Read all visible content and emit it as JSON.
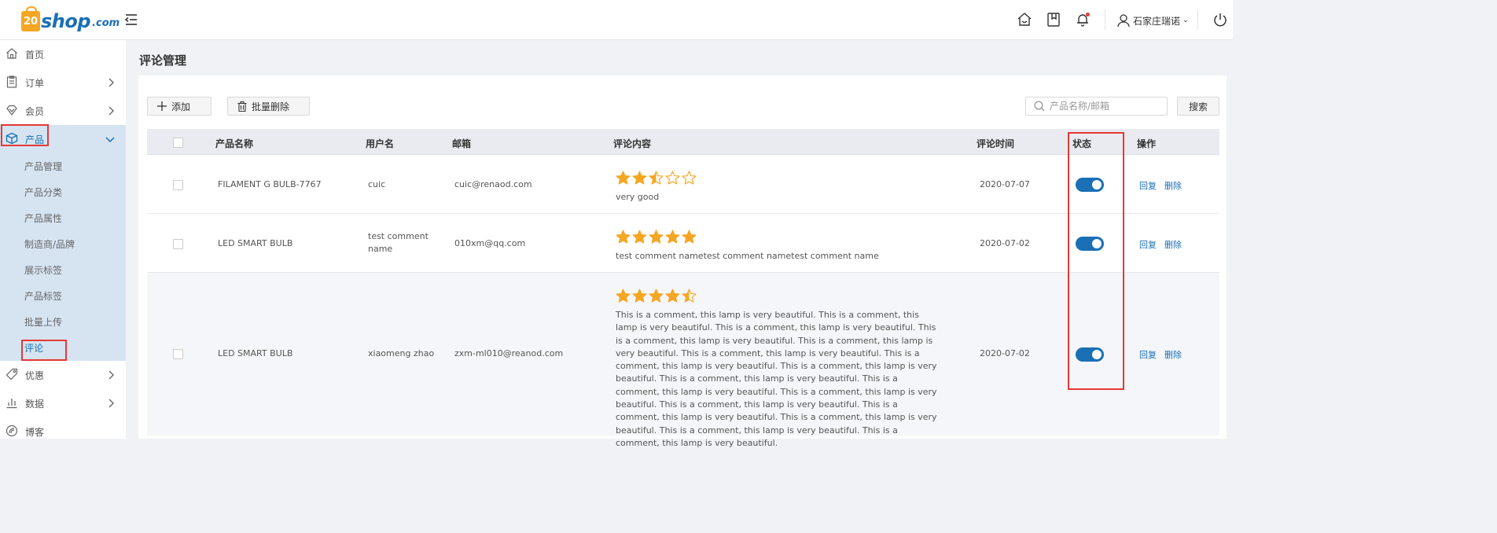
{
  "header": {
    "logo_mark": "20",
    "logo_text": "shop",
    "logo_suffix": ".com",
    "username": "石家庄瑞诺"
  },
  "sidebar": {
    "items": [
      {
        "label": "首页",
        "icon": "home-icon"
      },
      {
        "label": "订单",
        "icon": "order-icon"
      },
      {
        "label": "会员",
        "icon": "member-icon"
      },
      {
        "label": "产品",
        "icon": "product-icon"
      },
      {
        "label": "优惠",
        "icon": "coupon-icon"
      },
      {
        "label": "数据",
        "icon": "chart-icon"
      },
      {
        "label": "博客",
        "icon": "blog-icon"
      }
    ],
    "sub_items": [
      "产品管理",
      "产品分类",
      "产品属性",
      "制造商/品牌",
      "展示标签",
      "产品标签",
      "批量上传",
      "评论"
    ]
  },
  "page": {
    "title": "评论管理"
  },
  "toolbar": {
    "add_label": "添加",
    "batch_delete_label": "批量删除",
    "search_placeholder": "产品名称/邮箱",
    "search_label": "搜索"
  },
  "table": {
    "columns": [
      "产品名称",
      "用户名",
      "邮箱",
      "评论内容",
      "评论时间",
      "状态",
      "操作"
    ],
    "rows": [
      {
        "product": "FILAMENT G BULB-7767",
        "username": "cuic",
        "email": "cuic@renaod.com",
        "rating": 2.5,
        "comment": "very good",
        "time": "2020-07-07",
        "enabled": true,
        "reply": "回复",
        "delete": "删除"
      },
      {
        "product": "LED SMART BULB",
        "username": "test comment name",
        "email": "010xm@qq.com",
        "rating": 5,
        "comment": "test comment nametest comment nametest comment name",
        "time": "2020-07-02",
        "enabled": true,
        "reply": "回复",
        "delete": "删除"
      },
      {
        "product": "LED SMART BULB",
        "username": "xiaomeng zhao",
        "email": "zxm-ml010@reanod.com",
        "rating": 4.5,
        "comment": "This is a comment, this lamp is very beautiful. This is a comment, this lamp is very beautiful. This is a comment, this lamp is very beautiful. This is a comment, this lamp is very beautiful. This is a comment, this lamp is very beautiful. This is a comment, this lamp is very beautiful. This is a comment, this lamp is very beautiful. This is a comment, this lamp is very beautiful. This is a comment, this lamp is very beautiful. This is a comment, this lamp is very beautiful. This is a comment, this lamp is very beautiful. This is a comment, this lamp is very beautiful. This is a comment, this lamp is very beautiful. This is a comment, this lamp is very beautiful. This is a comment, this lamp is very beautiful. This is a comment, this lamp is very beautiful.",
        "time": "2020-07-02",
        "enabled": true,
        "reply": "回复",
        "delete": "删除"
      }
    ]
  },
  "colors": {
    "accent": "#1a6fb5",
    "star": "#f5a623",
    "highlight": "#e53935"
  }
}
